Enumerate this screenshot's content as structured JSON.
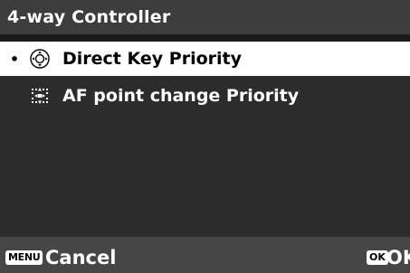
{
  "title": "4-way Controller",
  "items": [
    {
      "bullet": "•",
      "label": "Direct Key Priority",
      "icon": "direct-key-icon",
      "selected": true
    },
    {
      "bullet": "",
      "label": "AF point change Priority",
      "icon": "af-point-icon",
      "selected": false
    }
  ],
  "footer": {
    "menu_button": "MENU",
    "cancel_label": "Cancel",
    "ok_button": "OK",
    "ok_label": "OK"
  },
  "colors": {
    "selected_bg": "#ffffff",
    "background": "#2c2c2c",
    "title_bg": "#3d3d3d",
    "footer_bg": "#464646"
  }
}
